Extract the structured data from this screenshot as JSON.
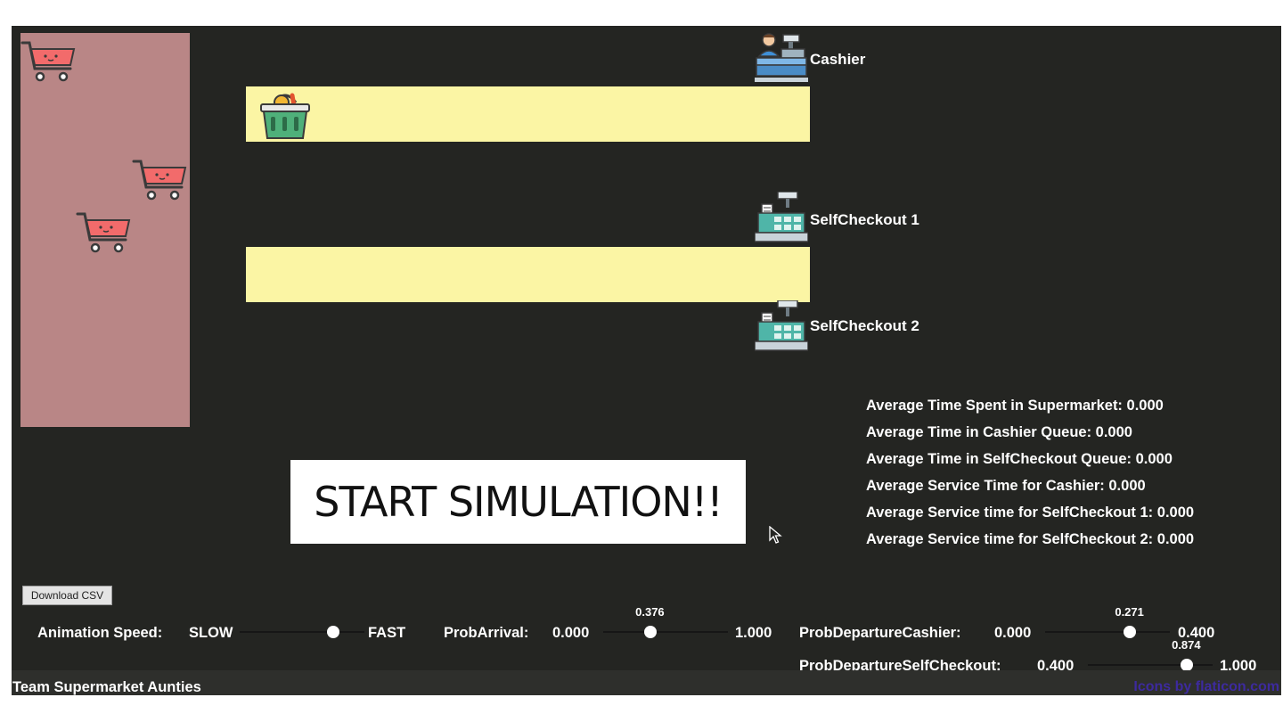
{
  "stations": {
    "cashier": "Cashier",
    "selfcheckout1": "SelfCheckout 1",
    "selfcheckout2": "SelfCheckout 2"
  },
  "stats": [
    "Average Time Spent in Supermarket: 0.000",
    "Average Time in Cashier Queue: 0.000",
    "Average Time in SelfCheckout Queue: 0.000",
    "Average Service Time for Cashier: 0.000",
    "Average Service time for SelfCheckout 1: 0.000",
    "Average Service time for SelfCheckout 2: 0.000"
  ],
  "start_button": "START SIMULATION!!",
  "download_button": "Download CSV",
  "controls": {
    "animation_speed": {
      "label": "Animation Speed:",
      "min_label": "SLOW",
      "max_label": "FAST",
      "level": 0.75
    },
    "prob_arrival": {
      "label": "ProbArrival:",
      "min": "0.000",
      "max": "1.000",
      "value": "0.376",
      "fraction": 0.376
    },
    "prob_departure_cashier": {
      "label": "ProbDepartureCashier:",
      "min": "0.000",
      "max": "0.400",
      "value": "0.271",
      "fraction": 0.6775
    },
    "prob_departure_selfcheckout": {
      "label": "ProbDepartureSelfCheckout:",
      "min": "0.400",
      "max": "1.000",
      "value": "0.874",
      "fraction": 0.79
    }
  },
  "footer": {
    "team": "Team Supermarket Aunties",
    "credits": "Icons by flaticon.com"
  },
  "colors": {
    "background": "#242522",
    "store_area": "#b98686",
    "queue_lane": "#fbf5a4",
    "cart": "#f26b6b",
    "credits_link": "#3d2a9e"
  }
}
